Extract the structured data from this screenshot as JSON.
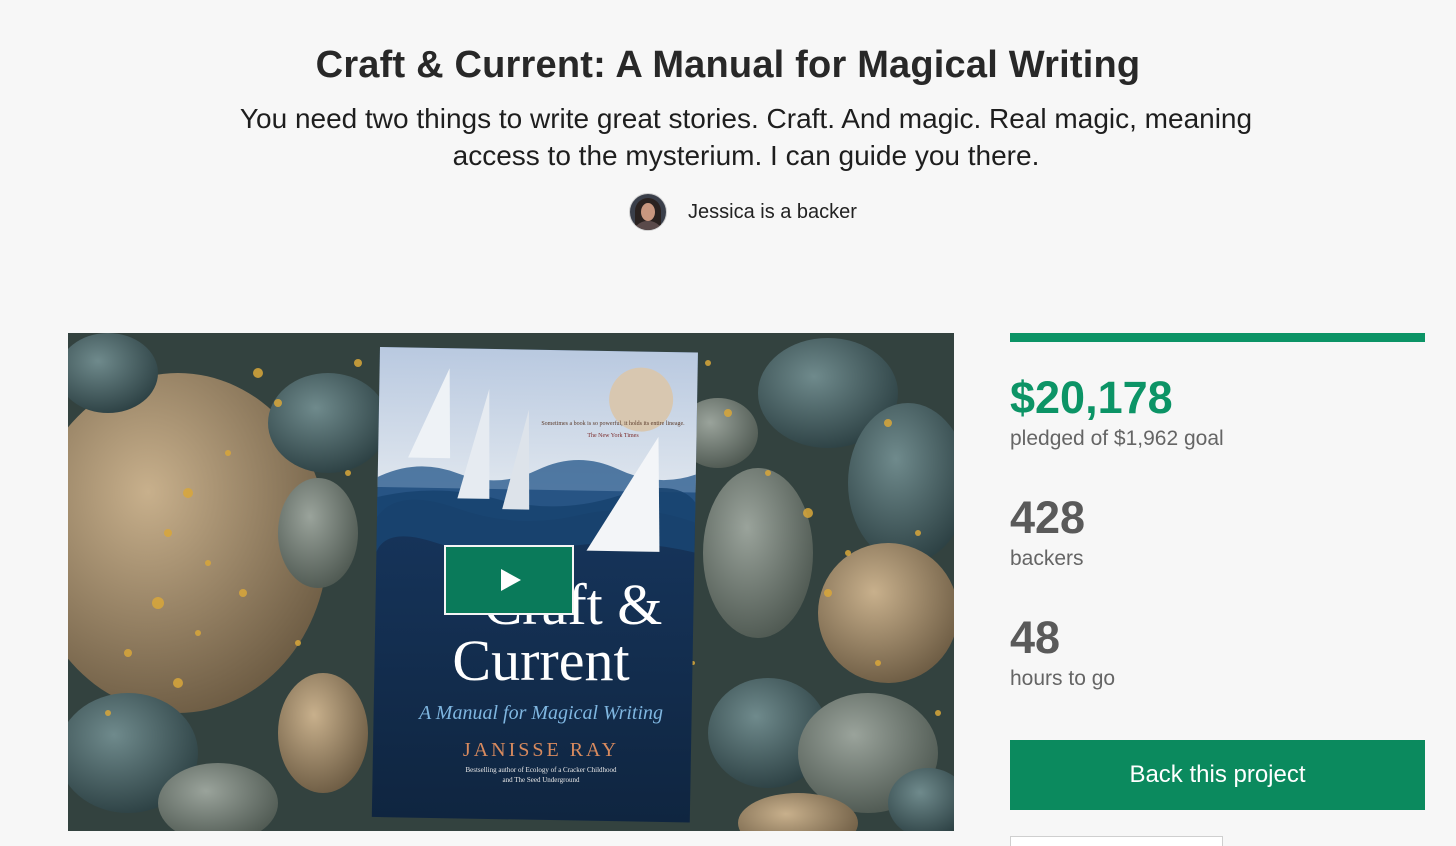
{
  "project": {
    "title": "Craft & Current: A Manual for Magical Writing",
    "blurb": "You need two things to write great stories. Craft. And magic. Real magic, meaning access to the mysterium. I can guide you there.",
    "backer_note": "Jessica is a backer"
  },
  "video": {
    "book_title_line1": "Craft &",
    "book_title_line2": "Current",
    "book_subtitle": "A Manual for Magical Writing",
    "book_author": "JANISSE RAY",
    "book_tagline_1": "Bestselling author of Ecology of a Cracker Childhood",
    "book_tagline_2": "and The Seed Underground",
    "book_quote": "Sometimes a book is so powerful, it holds its entire lineage.",
    "book_quote_source": "The New York Times",
    "play_icon": "play-icon"
  },
  "stats": {
    "funding_progress": 1.0,
    "pledged_amount": "$20,178",
    "pledged_label": "pledged of $1,962 goal",
    "backers_count": "428",
    "backers_label": "backers",
    "time_left": "48",
    "time_label": "hours to go"
  },
  "actions": {
    "back_label": "Back this project"
  },
  "colors": {
    "accent": "#0c9466",
    "button": "#0b8a5e",
    "background": "#f7f7f7"
  }
}
